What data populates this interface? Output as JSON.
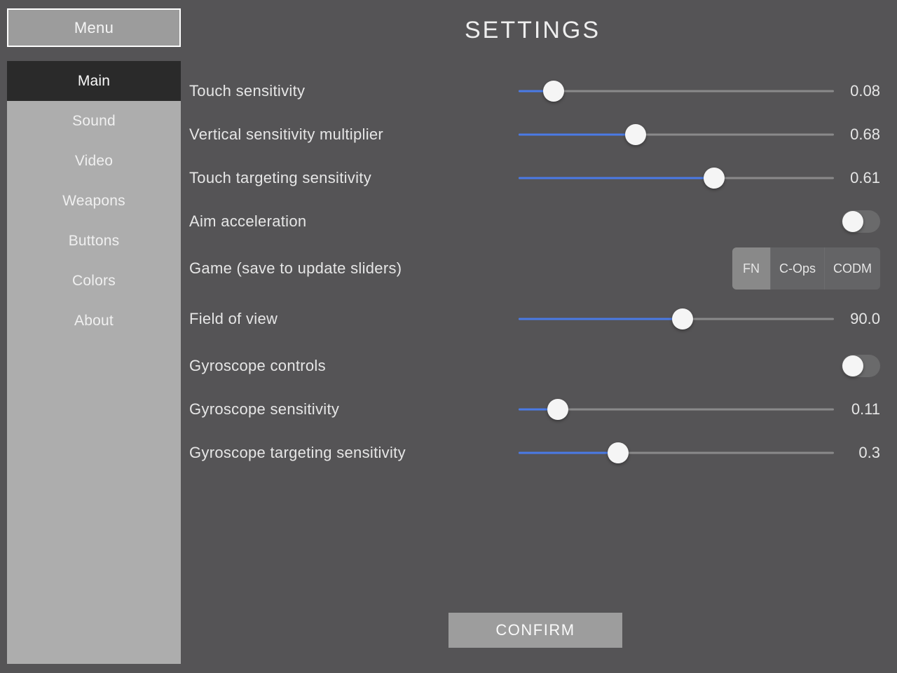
{
  "title": "SETTINGS",
  "menu_button": "Menu",
  "confirm_button": "CONFIRM",
  "sidebar": {
    "items": [
      {
        "label": "Main",
        "active": true
      },
      {
        "label": "Sound",
        "active": false
      },
      {
        "label": "Video",
        "active": false
      },
      {
        "label": "Weapons",
        "active": false
      },
      {
        "label": "Buttons",
        "active": false
      },
      {
        "label": "Colors",
        "active": false
      },
      {
        "label": "About",
        "active": false
      }
    ]
  },
  "settings": {
    "touch_sensitivity": {
      "label": "Touch sensitivity",
      "value": "0.08",
      "fill_pct": 11.0
    },
    "vertical_multiplier": {
      "label": "Vertical sensitivity multiplier",
      "value": "0.68",
      "fill_pct": 37.0
    },
    "touch_targeting": {
      "label": "Touch targeting sensitivity",
      "value": "0.61",
      "fill_pct": 62.0
    },
    "aim_acceleration": {
      "label": "Aim acceleration",
      "on": false
    },
    "game_mode": {
      "label": "Game (save to update sliders)",
      "options": [
        "FN",
        "C-Ops",
        "CODM"
      ],
      "selected_index": 0
    },
    "field_of_view": {
      "label": "Field of view",
      "value": "90.0",
      "fill_pct": 52.0
    },
    "gyro_controls": {
      "label": "Gyroscope controls",
      "on": false
    },
    "gyro_sensitivity": {
      "label": "Gyroscope sensitivity",
      "value": "0.11",
      "fill_pct": 12.5
    },
    "gyro_targeting": {
      "label": "Gyroscope targeting sensitivity",
      "value": "0.3",
      "fill_pct": 31.5
    }
  },
  "colors": {
    "accent": "#4a7ae6",
    "thumb": "#f5f5f5",
    "sidebar_bg": "#adadad",
    "active_nav_bg": "#2a2a2a"
  }
}
